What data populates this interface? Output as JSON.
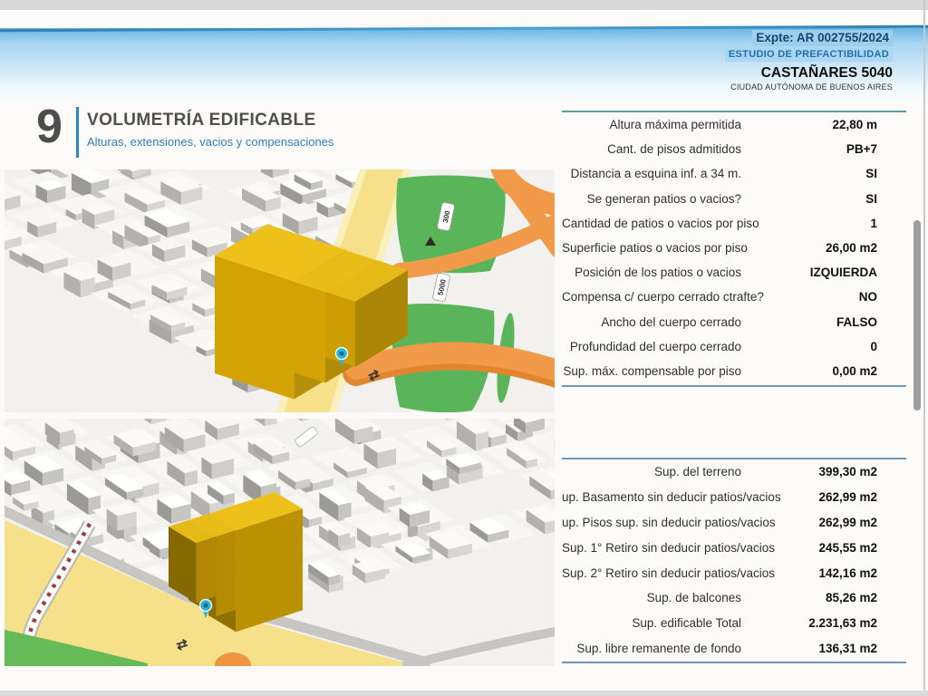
{
  "header": {
    "expediente": "Expte: AR 002755/2024",
    "study": "ESTUDIO DE PREFACTIBILIDAD",
    "address": "CASTAÑARES 5040",
    "city": "CIUDAD AUTÓNOMA DE BUENOS AIRES"
  },
  "section": {
    "number": "9",
    "title": "VOLUMETRÍA EDIFICABLE",
    "subtitle": "Alturas, extensiones, vacios y compensaciones"
  },
  "volumetry_table": {
    "rows": [
      {
        "label": "Altura máxima permitida",
        "value": "22,80 m"
      },
      {
        "label": "Cant. de pisos admitidos",
        "value": "PB+7"
      },
      {
        "label": "Distancia a esquina inf. a 34 m.",
        "value": "SI"
      },
      {
        "label": "Se generan patios o vacios?",
        "value": "SI"
      },
      {
        "label": "Cantidad de patios o vacios por piso",
        "value": "1"
      },
      {
        "label": "Superficie patios o vacios por piso",
        "value": "26,00 m2"
      },
      {
        "label": "Posición de los patios o vacios",
        "value": "IZQUIERDA"
      },
      {
        "label": "Compensa c/ cuerpo cerrado ctrafte?",
        "value": "NO"
      },
      {
        "label": "Ancho del  cuerpo cerrado",
        "value": "FALSO"
      },
      {
        "label": "Profundidad del  cuerpo cerrado",
        "value": "0"
      },
      {
        "label": "Sup. máx. compensable por piso",
        "value": "0,00 m2"
      }
    ]
  },
  "surfaces_table": {
    "rows": [
      {
        "label": "Sup. del terreno",
        "value": "399,30 m2"
      },
      {
        "label": "up. Basamento sin deducir patios/vacios",
        "value": "262,99 m2"
      },
      {
        "label": "up. Pisos sup. sin deducir patios/vacios",
        "value": "262,99 m2"
      },
      {
        "label": "Sup. 1° Retiro sin deducir patios/vacios",
        "value": "245,55 m2"
      },
      {
        "label": "Sup. 2° Retiro sin deducir patios/vacios",
        "value": "142,16 m2"
      },
      {
        "label": "Sup. de balcones",
        "value": "85,26 m2"
      },
      {
        "label": "Sup. edificable Total",
        "value": "2.231,63 m2"
      },
      {
        "label": "Sup. libre remanente de fondo",
        "value": "136,31 m2"
      }
    ]
  },
  "maps": {
    "top": {
      "street_label_1": "5000",
      "street_label_2": "300",
      "lane_marker": "⇄"
    },
    "bottom": {
      "lane_marker": "⇄"
    }
  },
  "colors": {
    "accent_blue": "#2e86c1",
    "teal_line": "#5f9e98",
    "table_line": "#7396b5",
    "building_yellow": "#eec11a",
    "park_green": "#5ab55a",
    "road_orange": "#f09a4a",
    "avenue_yellow": "#f6e08a",
    "pin_teal": "#2fb3d4"
  }
}
